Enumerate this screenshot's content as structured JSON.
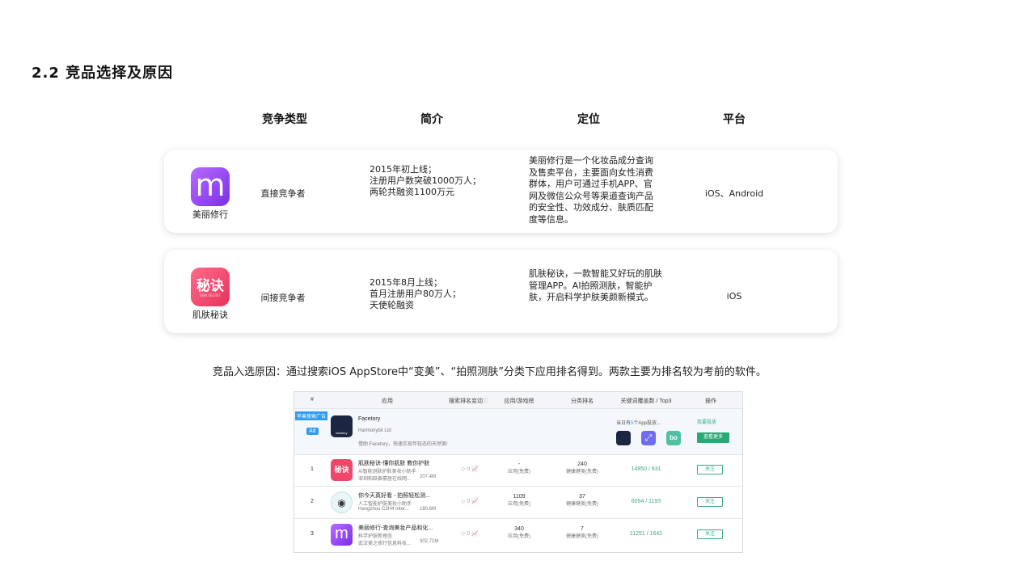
{
  "page": {
    "title": "2.2 竞品选择及原因",
    "columns": [
      "竞争类型",
      "简介",
      "定位",
      "平台"
    ],
    "reason": "竞品入选原因：通过搜索iOS AppStore中“变美”、“拍照测肤”分类下应用排名得到。两款主要为排名较为考前的软件。"
  },
  "competitors": [
    {
      "icon_text": "m",
      "name": "美丽修行",
      "type": "直接竞争者",
      "intro": [
        "2015年初上线；",
        "注册用户数突破1000万人；",
        "两轮共融资1100万元"
      ],
      "position": [
        "美丽修行是一个化妆品成分查询",
        "及售卖平台，主要面向女性消费",
        "群体，用户可通过手机APP、官",
        "网及微信公众号等渠道查询产品",
        "的安全性、功效成分、肤质匹配",
        "度等信息。"
      ],
      "platform": "iOS、Android"
    },
    {
      "icon_text": "秘诀",
      "icon_sub": "SKIN SECRET",
      "name": "肌肤秘诀",
      "type": "间接竞争者",
      "intro": [
        "2015年8月上线；",
        "首月注册用户80万人；",
        "天使轮融资"
      ],
      "position": [
        "肌肤秘诀，一款智能又好玩的肌肤",
        "管理APP。AI拍照测肤，智能护",
        "肤，开启科学护肤美颜新模式。"
      ],
      "platform": "iOS"
    }
  ],
  "shot": {
    "headers": [
      "#",
      "应用",
      "搜索排名变动",
      "应用/游戏榜",
      "分类排名",
      "关键词覆盖数 / Top3",
      "操作"
    ],
    "ad": {
      "badge": "苹果搜索广告",
      "tag": "Ad",
      "name": "Facetory",
      "dev": "Harmonybit Ltd",
      "desc": "借助 Facetory，快速实现年轻态的天然美!",
      "icon_text": "facetory",
      "placement_prefix": "当日有",
      "placement_count": "5",
      "placement_suffix": "个App投放...",
      "bid": "我要投放",
      "more": "查看更多"
    },
    "rows": [
      {
        "rank": "1",
        "name": "肌肤秘诀-懂你肌肤 教你护肤",
        "sub": "AI智能测肤护肤美妆小助手",
        "dev": "深圳柏跃泰豪居在线网...",
        "size": "207.4M",
        "change": "0",
        "app_rank": "-",
        "app_rank_sub": "应用(免费)",
        "cat_rank": "240",
        "cat_rank_sub": "健康健美(免费)",
        "kw": "14850 / 931",
        "action": "关注"
      },
      {
        "rank": "2",
        "name": "你今天真好看 - 拍照轻松测...",
        "sub": "人工智能护肤美妆小助手",
        "dev": "Hangzhou C2H4 Inter...",
        "size": "180.6M",
        "change": "0",
        "app_rank": "1109",
        "app_rank_sub": "应用(免费)",
        "cat_rank": "37",
        "cat_rank_sub": "健康健美(免费)",
        "kw": "6094 / 1193",
        "action": "关注"
      },
      {
        "rank": "3",
        "name": "美丽修行-查询美妆产品和化...",
        "sub": "科学护肤新理念",
        "dev": "武汉美之修行信息科技...",
        "size": "302.71M",
        "change": "0",
        "app_rank": "340",
        "app_rank_sub": "应用(免费)",
        "cat_rank": "7",
        "cat_rank_sub": "健康健美(免费)",
        "kw": "11251 / 1642",
        "action": "关注"
      }
    ]
  },
  "colors": {
    "purple": "#8a3ff0",
    "pink": "#f0466a",
    "accent": "#3aaa8a",
    "blue": "#2f9cf2"
  }
}
